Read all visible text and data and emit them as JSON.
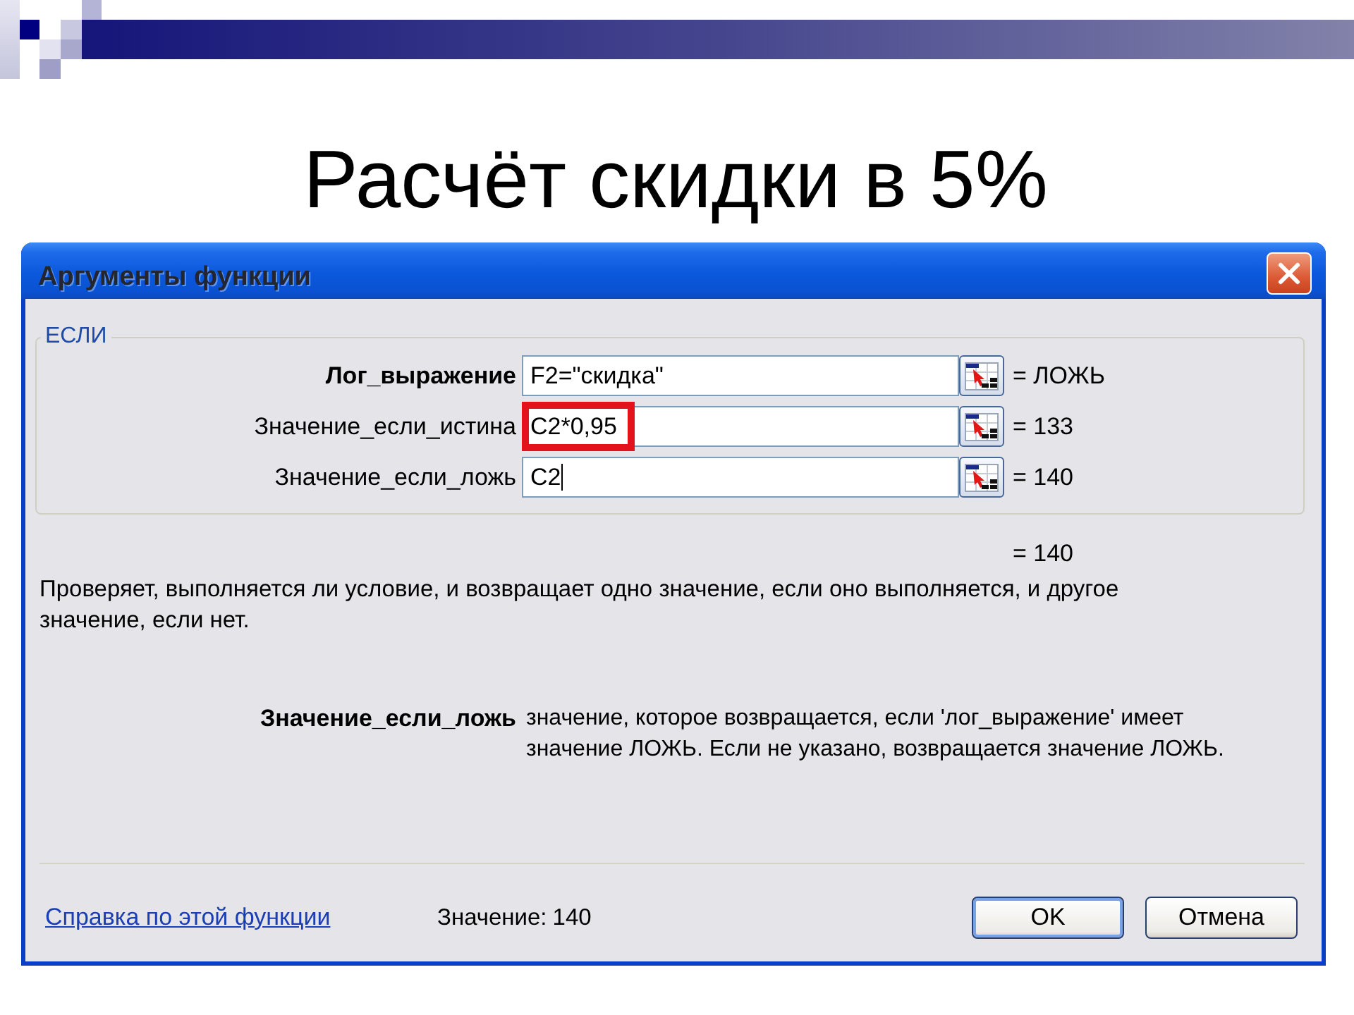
{
  "slide": {
    "title": "Расчёт скидки в 5%"
  },
  "dialog": {
    "title": "Аргументы функции",
    "function_name": "ЕСЛИ",
    "arguments": [
      {
        "label": "Лог_выражение",
        "value": "F2=\"скидка\"",
        "result": "= ЛОЖЬ",
        "required": true,
        "highlighted": false,
        "focused": false
      },
      {
        "label": "Значение_если_истина",
        "value": "C2*0,95",
        "result": "= 133",
        "required": false,
        "highlighted": true,
        "focused": false
      },
      {
        "label": "Значение_если_ложь",
        "value": "C2",
        "result": "= 140",
        "required": false,
        "highlighted": false,
        "focused": true
      }
    ],
    "formula_result": "= 140",
    "description": "Проверяет, выполняется ли условие, и возвращает одно значение, если оно выполняется, и другое значение, если нет.",
    "argument_help": {
      "label": "Значение_если_ложь",
      "text": "значение, которое возвращается, если 'лог_выражение' имеет значение ЛОЖЬ. Если не указано, возвращается значение ЛОЖЬ."
    },
    "help_link": "Справка по этой функции",
    "value_label": "Значение:",
    "value": "140",
    "buttons": [
      {
        "label": "OK",
        "default": true
      },
      {
        "label": "Отмена",
        "default": false
      }
    ]
  }
}
